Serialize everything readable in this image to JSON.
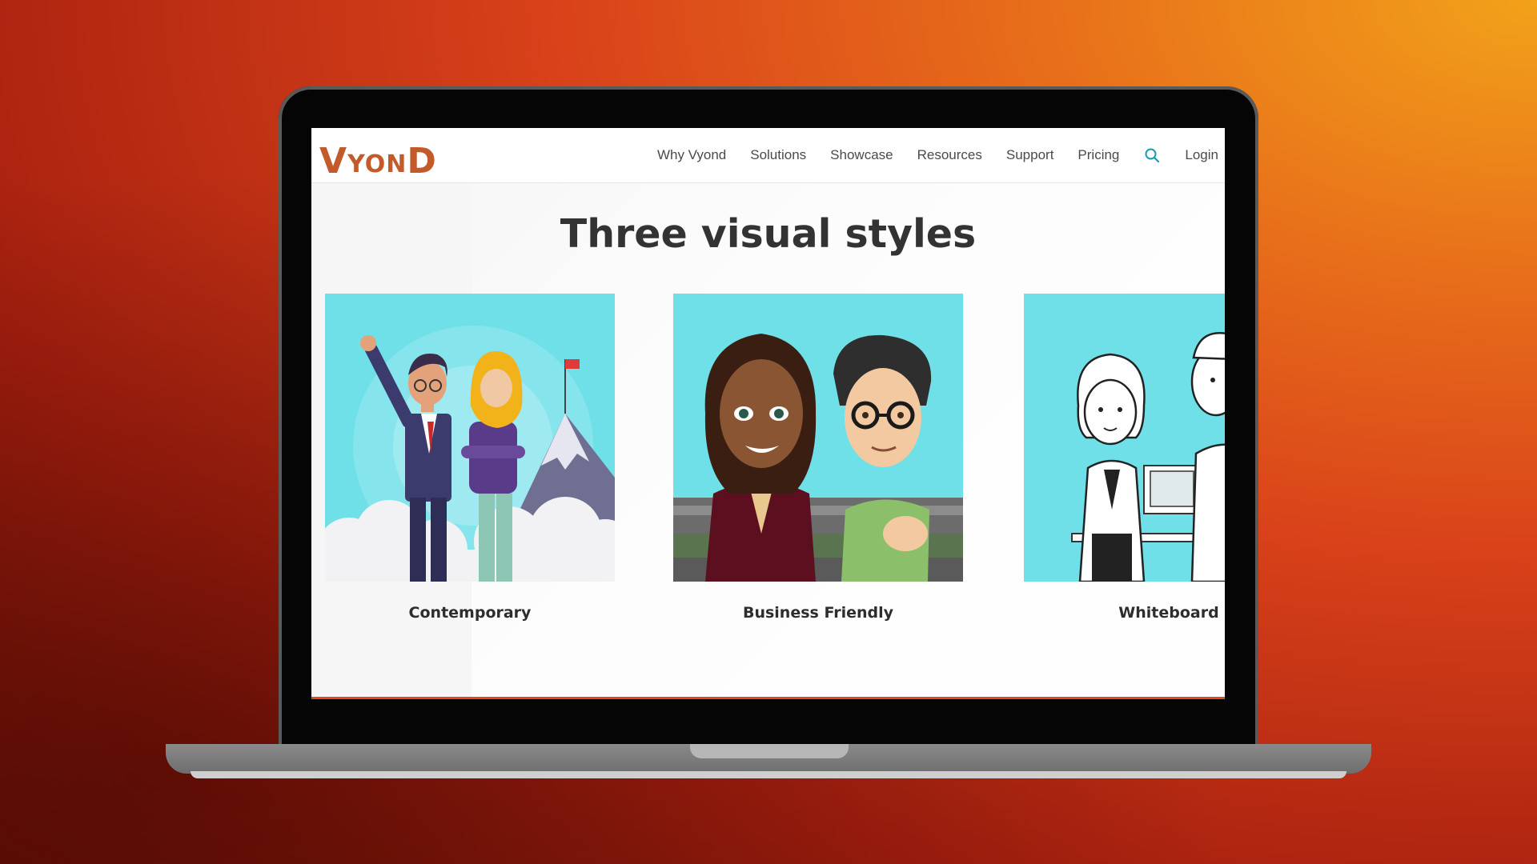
{
  "brand": {
    "logo_text_1": "V",
    "logo_text_2": "YON",
    "logo_text_3": "D"
  },
  "nav": {
    "items": [
      {
        "label": "Why Vyond"
      },
      {
        "label": "Solutions"
      },
      {
        "label": "Showcase"
      },
      {
        "label": "Resources"
      },
      {
        "label": "Support"
      },
      {
        "label": "Pricing"
      }
    ],
    "search_icon": "search-icon",
    "login_label": "Login"
  },
  "main": {
    "heading": "Three visual styles",
    "styles": [
      {
        "label": "Contemporary"
      },
      {
        "label": "Business Friendly"
      },
      {
        "label": "Whiteboard"
      }
    ]
  },
  "colors": {
    "brand": "#c25a2c",
    "accent": "#1a9bb0",
    "card_sky": "#6fe0e8",
    "background_orange": "#e8701a",
    "background_red": "#a8200f"
  }
}
